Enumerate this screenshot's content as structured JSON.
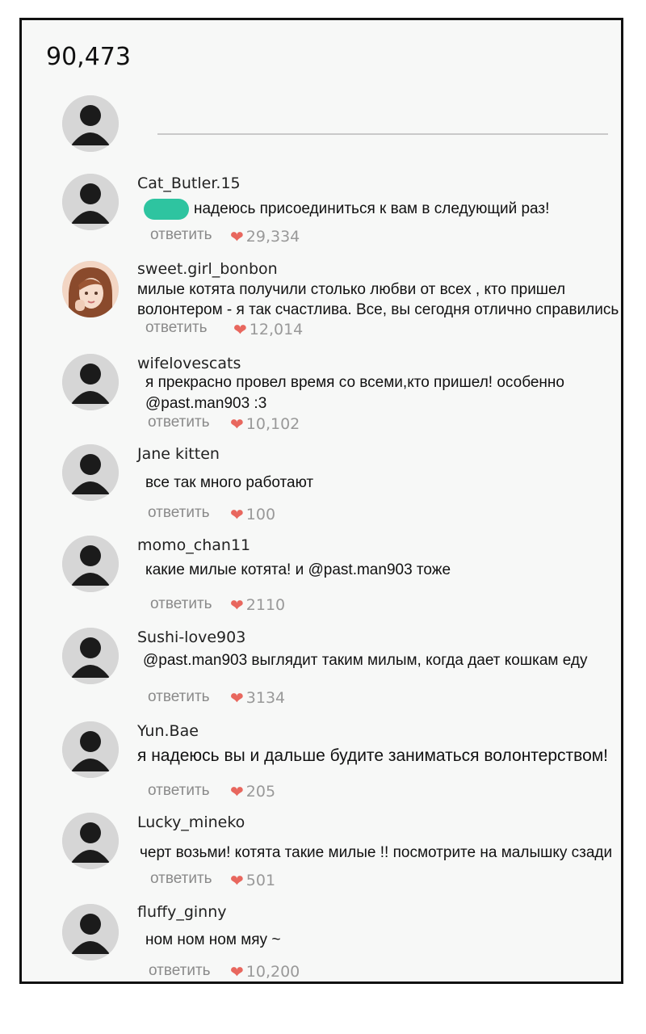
{
  "count": "90,473",
  "reply_label": "ответить",
  "colors": {
    "heart": "#e8675e",
    "sticker": "#2ec4a0",
    "border": "#111111"
  },
  "comments": [
    {
      "username": "Cat_Butler.15",
      "text": "надеюсь присоединиться к вам в следующий раз!",
      "likes": "29,334",
      "has_sticker": true
    },
    {
      "username": "sweet.girl_bonbon",
      "text_lines": [
        "милые котята получили столько любви от всех , кто пришел",
        "волонтером - я так счастлива. Все, вы сегодня отлично справились"
      ],
      "likes": "12,014",
      "avatar": "photo"
    },
    {
      "username": "wifelovescats",
      "text_lines": [
        "я прекрасно провел время со всеми,кто пришел! особенно",
        "@past.man903 :3"
      ],
      "likes": "10,102"
    },
    {
      "username": "Jane kitten",
      "text": "все так много работают",
      "likes": "100"
    },
    {
      "username": "momo_chan11",
      "text": "какие милые котята! и @past.man903 тоже",
      "likes": "2110"
    },
    {
      "username": "Sushi-love903",
      "text": "@past.man903 выглядит таким милым, когда дает кошкам еду",
      "likes": "3134"
    },
    {
      "username": "Yun.Bae",
      "text": "я надеюсь вы и дальше будите заниматься волонтерством!",
      "likes": "205"
    },
    {
      "username": "Lucky_mineko",
      "text": "черт возьми! котята такие милые !! посмотрите на малышку сзади",
      "likes": "501"
    },
    {
      "username": "fluffy_ginny",
      "text": "ном ном ном мяу ~",
      "likes": "10,200"
    }
  ]
}
